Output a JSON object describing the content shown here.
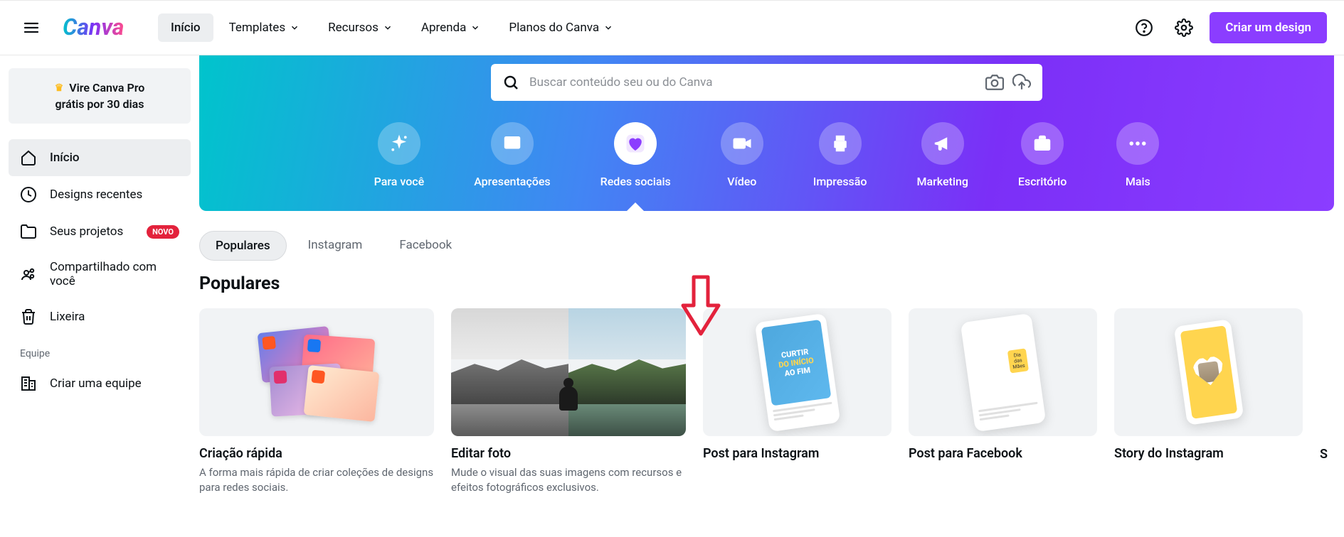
{
  "header": {
    "nav": {
      "home": "Início",
      "templates": "Templates",
      "resources": "Recursos",
      "learn": "Aprenda",
      "plans": "Planos do Canva"
    },
    "create_button": "Criar um design"
  },
  "sidebar": {
    "pro": {
      "line1": "Vire Canva Pro",
      "line2": "grátis por 30 dias"
    },
    "items": {
      "home": "Início",
      "recent": "Designs recentes",
      "projects": "Seus projetos",
      "shared": "Compartilhado com você",
      "trash": "Lixeira"
    },
    "badge_new": "NOVO",
    "team_label": "Equipe",
    "create_team": "Criar uma equipe"
  },
  "hero": {
    "search_placeholder": "Buscar conteúdo seu ou do Canva",
    "categories": {
      "for_you": "Para você",
      "presentations": "Apresentações",
      "social": "Redes sociais",
      "video": "Vídeo",
      "print": "Impressão",
      "marketing": "Marketing",
      "office": "Escritório",
      "more": "Mais"
    }
  },
  "tabs": {
    "popular": "Populares",
    "instagram": "Instagram",
    "facebook": "Facebook"
  },
  "section": {
    "title": "Populares",
    "cards": {
      "quick": {
        "title": "Criação rápida",
        "desc": "A forma mais rápida de criar coleções de designs para redes sociais."
      },
      "edit": {
        "title": "Editar foto",
        "desc": "Mude o visual das suas imagens com recursos e efeitos fotográficos exclusivos."
      },
      "ig_post": {
        "title": "Post para Instagram",
        "text_line1": "CURTIR",
        "text_line2": "DO INÍCIO",
        "text_line3": "AO FIM"
      },
      "fb_post": {
        "title": "Post para Facebook"
      },
      "ig_story": {
        "title": "Story do Instagram"
      },
      "next_initial": "S"
    }
  },
  "colors": {
    "accent": "#8b3dff"
  }
}
